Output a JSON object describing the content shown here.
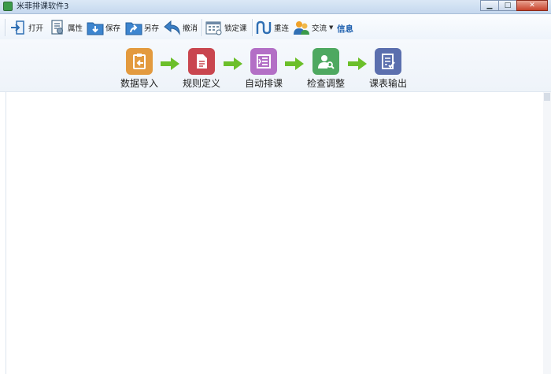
{
  "window": {
    "title": "米菲排课软件3",
    "controls": {
      "minimize": "▁",
      "maximize": "□",
      "close": "✕"
    }
  },
  "toolbar": {
    "items": [
      {
        "label": "打开",
        "icon": "open-icon"
      },
      {
        "label": "属性",
        "icon": "properties-icon"
      },
      {
        "label": "保存",
        "icon": "save-icon"
      },
      {
        "label": "另存",
        "icon": "save-as-icon"
      },
      {
        "label": "撤消",
        "icon": "undo-icon"
      },
      {
        "label": "锁定课",
        "icon": "lock-course-icon"
      },
      {
        "label": "重连",
        "icon": "reconnect-icon"
      },
      {
        "label": "交流",
        "icon": "users-icon"
      }
    ],
    "info_label": "信息"
  },
  "workflow": {
    "steps": [
      {
        "label": "数据导入",
        "color": "#e39a3e"
      },
      {
        "label": "规则定义",
        "color": "#c9464f"
      },
      {
        "label": "自动排课",
        "color": "#b36fc6"
      },
      {
        "label": "检查调整",
        "color": "#4ea860"
      },
      {
        "label": "课表输出",
        "color": "#5b6fae"
      }
    ],
    "arrow_color": "#6cbf2a"
  }
}
